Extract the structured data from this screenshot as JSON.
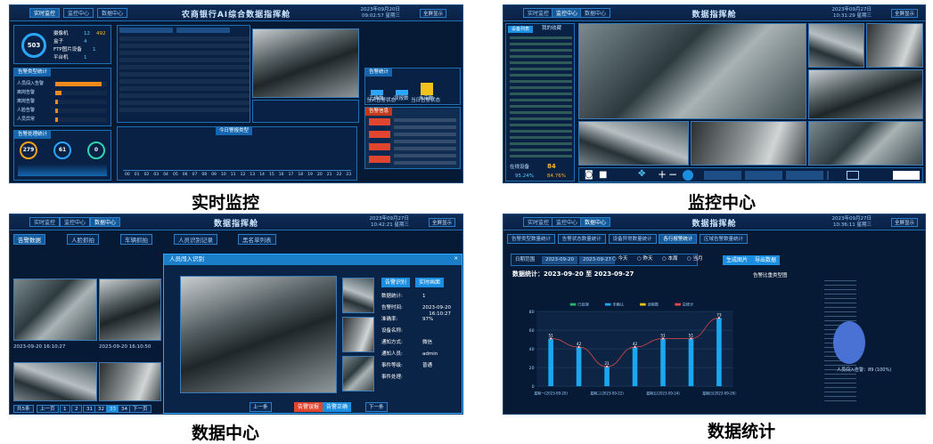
{
  "p1": {
    "caption": "实时监控",
    "title": "农商银行AI综合数据指挥舱",
    "tabs": [
      "实时监控",
      "监控中心",
      "数据中心"
    ],
    "tab_active": 0,
    "datetime": "2023年09月20日\n09:02:57 星期三",
    "right_btn": "全屏显示",
    "ring_value": "503",
    "stats": [
      {
        "label": "摄像机",
        "a": "12",
        "b": "492"
      },
      {
        "label": "盒子",
        "a": "4",
        "b": ""
      },
      {
        "label": "FTP图片设备",
        "a": "1",
        "b": ""
      },
      {
        "label": "平台机",
        "a": "1",
        "b": ""
      }
    ],
    "bars_title": "告警类型统计",
    "bars": [
      {
        "label": "人员闯入告警",
        "v": 0.9
      },
      {
        "label": "离岗告警",
        "v": 0.12
      },
      {
        "label": "离岗告警",
        "v": 0.05
      },
      {
        "label": "人脸告警",
        "v": 0.05
      },
      {
        "label": "人员异常",
        "v": 0.05
      }
    ],
    "circles_title": "告警处理统计",
    "circles": [
      {
        "v": "279",
        "label": "人员闯入统计"
      },
      {
        "v": "61",
        "label": "离岗统计"
      },
      {
        "v": "0",
        "label": "口罩未戴"
      }
    ],
    "chart_title": "今日警报类型",
    "right_title": "告警统计",
    "right_labels": [
      "正确数",
      "误报数",
      "未审数"
    ],
    "right_items": [
      "当天告警状态",
      "当日告警状态"
    ],
    "alarm_title": "告警信息",
    "axis_hours": [
      "00",
      "01",
      "02",
      "03",
      "04",
      "05",
      "06",
      "07",
      "08",
      "09",
      "10",
      "11",
      "12",
      "13",
      "14",
      "15",
      "16",
      "17",
      "18",
      "19",
      "20",
      "21",
      "22",
      "23"
    ]
  },
  "p2": {
    "caption": "监控中心",
    "title": "数据指挥舱",
    "tabs": [
      "实时监控",
      "监控中心",
      "数据中心"
    ],
    "tab_active": 1,
    "datetime": "2023年09月27日\n10:31:29 星期三",
    "right_btn": "全屏显示",
    "tree_tabs": [
      "设备列表",
      "我的收藏"
    ],
    "online_label": "在线设备",
    "online_count": "84",
    "pct1": "95.24%",
    "pct2": "84.76%"
  },
  "p3": {
    "caption": "数据中心",
    "title": "数据指挥舱",
    "tabs": [
      "实时监控",
      "监控中心",
      "数据中心"
    ],
    "tab_active": 2,
    "datetime": "2023年09月27日\n10:42:21 星期三",
    "right_btn": "全屏显示",
    "subtabs": [
      "告警数据",
      "人脸抓拍",
      "车辆抓拍",
      "人员识别记录",
      "黑名单列表"
    ],
    "dialog_title": "人员闯入识别",
    "dialog_btns": [
      "告警识别",
      "实时画面"
    ],
    "info": [
      {
        "k": "数据统计:",
        "v": "1"
      },
      {
        "k": "告警时间:",
        "v": "2023-09-20\n16:10:27"
      },
      {
        "k": "准确率:",
        "v": "97%"
      },
      {
        "k": "设备名称:",
        "v": ""
      },
      {
        "k": "通知方式:",
        "v": "微信"
      },
      {
        "k": "通知人员:",
        "v": "admin"
      },
      {
        "k": "事件等级:",
        "v": "普通"
      },
      {
        "k": "事件处理:",
        "v": ""
      }
    ],
    "prev": "上一条",
    "next": "下一条",
    "red_btn": "告警误报",
    "blue_btn": "告警正确",
    "thumb_times": [
      "2023-09-20 16:10:27",
      "2023-09-20 16:10:50"
    ],
    "pager": [
      "共5条",
      "上一页",
      "1",
      "2",
      "31",
      "32",
      "33",
      "34",
      "下一页"
    ]
  },
  "p4": {
    "caption": "数据统计",
    "title": "数据指挥舱",
    "tabs": [
      "实时监控",
      "监控中心",
      "数据中心"
    ],
    "tab_active": 3,
    "datetime": "2023年09月27日\n10:36:11 星期三",
    "right_btn": "全屏显示",
    "subtabs": [
      "告警类型数量统计",
      "告警状态数量统计",
      "设备异常数量统计",
      "各行报警统计",
      "区域告警数量统计"
    ],
    "subtab_active": 3,
    "filter_label": "日期范围",
    "date_from": "2023-09-20",
    "date_to": "2023-09-27",
    "radios": [
      "今天",
      "昨天",
      "本周",
      "当月"
    ],
    "btn_query": "生成图片",
    "btn_export": "导出数据",
    "stat_title": "数据统计：2023-09-20 至 2023-09-27",
    "pie_title": "告警比重类型图",
    "pie_label": "人员闯入告警：89 (100%)"
  },
  "chart_data": {
    "type": "bar",
    "categories": [
      "星期一(2023-09-20)",
      "",
      "星期三(2023-09-22)",
      "",
      "星期五(2023-09-24)",
      "",
      "星期日(2023-09-26)"
    ],
    "series": [
      {
        "name": "本周统计",
        "values": [
          51,
          42,
          21,
          42,
          51,
          51,
          73
        ]
      }
    ],
    "ylim": [
      0,
      80
    ],
    "yticks": [
      0,
      20,
      40,
      60,
      80
    ],
    "legend": [
      "已处理",
      "未确认",
      "误报数",
      "总统计"
    ],
    "grid": true
  }
}
